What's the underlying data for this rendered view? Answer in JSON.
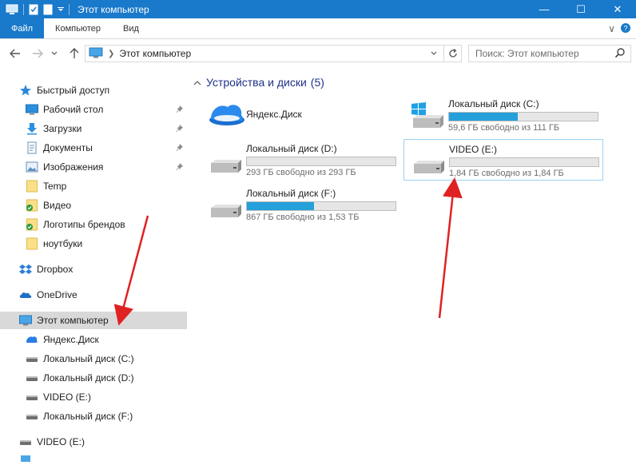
{
  "window": {
    "title": "Этот компьютер",
    "minimize": "—",
    "maximize": "☐",
    "close": "✕"
  },
  "ribbon": {
    "tabs": [
      {
        "label": "Файл"
      },
      {
        "label": "Компьютер"
      },
      {
        "label": "Вид"
      }
    ],
    "collapse_glyph": "∨",
    "help_glyph": "?"
  },
  "address": {
    "path": "Этот компьютер",
    "search_placeholder": "Поиск: Этот компьютер"
  },
  "sidebar": {
    "quick_access": "Быстрый доступ",
    "quick_items": [
      {
        "label": "Рабочий стол",
        "icon": "desktop-icon"
      },
      {
        "label": "Загрузки",
        "icon": "download-icon"
      },
      {
        "label": "Документы",
        "icon": "documents-icon"
      },
      {
        "label": "Изображения",
        "icon": "pictures-icon"
      },
      {
        "label": "Temp",
        "icon": "folder-icon"
      },
      {
        "label": "Видео",
        "icon": "folder-icon"
      },
      {
        "label": "Логотипы брендов",
        "icon": "folder-icon"
      },
      {
        "label": "ноутбуки",
        "icon": "folder-icon"
      }
    ],
    "dropbox": "Dropbox",
    "onedrive": "OneDrive",
    "this_pc": "Этот компьютер",
    "pc_items": [
      {
        "label": "Яндекс.Диск"
      },
      {
        "label": "Локальный диск (C:)"
      },
      {
        "label": "Локальный диск (D:)"
      },
      {
        "label": "VIDEO (E:)"
      },
      {
        "label": "Локальный диск (F:)"
      }
    ],
    "video_drive": "VIDEO (E:)"
  },
  "main": {
    "group_title": "Устройства и диски",
    "group_count": "(5)",
    "tiles": [
      {
        "name": "Яндекс.Диск"
      },
      {
        "name": "Локальный диск (C:)",
        "info": "59,6 ГБ свободно из 111 ГБ",
        "used": 0.46
      },
      {
        "name": "Локальный диск (D:)",
        "info": "293 ГБ свободно из 293 ГБ",
        "used": 0.0
      },
      {
        "name": "VIDEO (E:)",
        "info": "1,84 ГБ свободно из 1,84 ГБ",
        "used": 0.0
      },
      {
        "name": "Локальный диск (F:)",
        "info": "867 ГБ свободно из 1,53 ТБ",
        "used": 0.45
      }
    ]
  },
  "colors": {
    "titlebar": "#1979ca",
    "bar_fill": "#26a0da",
    "group_text": "#1e3287",
    "arrow": "#e02222"
  }
}
